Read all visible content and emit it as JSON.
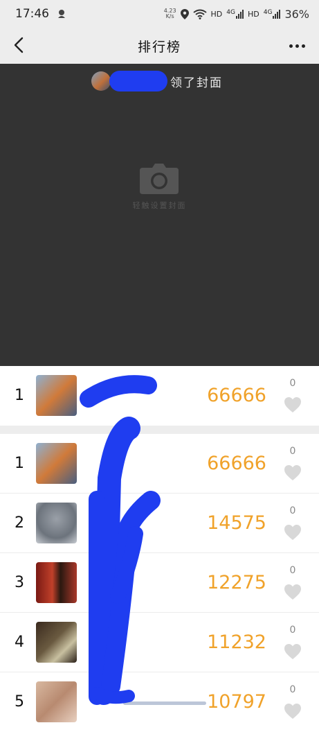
{
  "status_bar": {
    "time": "17:46",
    "net_speed_value": "4.23",
    "net_speed_unit": "K/s",
    "hd_label_1": "HD",
    "signal_label_1": "4G",
    "hd_label_2": "HD",
    "signal_label_2": "4G",
    "battery": "36%"
  },
  "nav": {
    "title": "排行榜"
  },
  "cover": {
    "claim_text": "领了封面",
    "hint_text": "轻触设置封面"
  },
  "my_entry": {
    "rank": "1",
    "name": "",
    "steps": "66666",
    "likes": "0"
  },
  "leaderboard": [
    {
      "rank": "1",
      "name": "",
      "steps": "66666",
      "likes": "0"
    },
    {
      "rank": "2",
      "name": "",
      "steps": "14575",
      "likes": "0"
    },
    {
      "rank": "3",
      "name": "",
      "steps": "12275",
      "likes": "0"
    },
    {
      "rank": "4",
      "name": "",
      "steps": "11232",
      "likes": "0"
    },
    {
      "rank": "5",
      "name": "",
      "steps": "10797",
      "likes": "0"
    }
  ],
  "colors": {
    "steps": "#f0a22a",
    "redaction": "#1f3df0",
    "cover_bg": "#333333",
    "header_bg": "#ededed",
    "heart": "#d8d8d8"
  },
  "icons": {
    "back": "chevron-left-icon",
    "more": "more-dots-icon",
    "camera": "camera-icon",
    "like": "heart-icon"
  }
}
